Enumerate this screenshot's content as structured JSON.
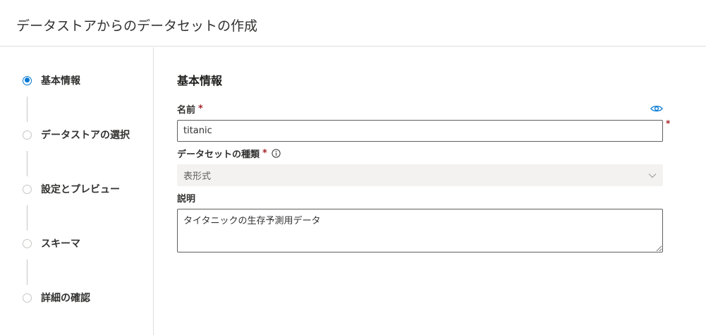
{
  "header": {
    "title": "データストアからのデータセットの作成"
  },
  "sidebar": {
    "steps": [
      {
        "label": "基本情報",
        "active": true
      },
      {
        "label": "データストアの選択",
        "active": false
      },
      {
        "label": "設定とプレビュー",
        "active": false
      },
      {
        "label": "スキーマ",
        "active": false
      },
      {
        "label": "詳細の確認",
        "active": false
      }
    ]
  },
  "main": {
    "section_title": "基本情報",
    "name_field": {
      "label": "名前",
      "required_mark": "*",
      "value": "titanic"
    },
    "dataset_type_field": {
      "label": "データセットの種類",
      "required_mark": "*",
      "selected": "表形式"
    },
    "description_field": {
      "label": "説明",
      "value": "タイタニックの生存予測用データ"
    }
  },
  "colors": {
    "accent": "#0078d4",
    "required": "#a4262c",
    "border": "#605e5c",
    "disabled_bg": "#f3f2f1"
  },
  "icons": [
    "eye-icon",
    "info-icon",
    "chevron-down-icon"
  ]
}
